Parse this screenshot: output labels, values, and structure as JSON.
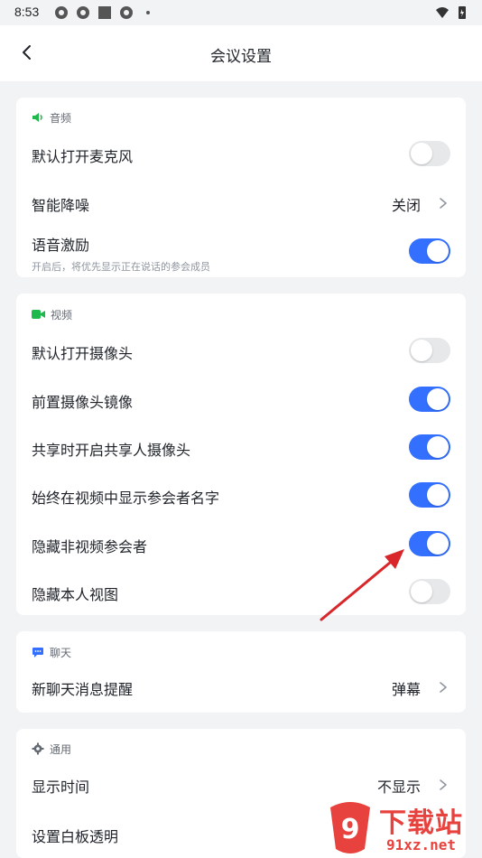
{
  "status_bar": {
    "time": "8:53"
  },
  "nav": {
    "title": "会议设置"
  },
  "sections": {
    "audio": {
      "header": "音频",
      "mic_default": {
        "label": "默认打开麦克风",
        "toggle": false
      },
      "noise": {
        "label": "智能降噪",
        "value": "关闭"
      },
      "voice_incentive": {
        "label": "语音激励",
        "sub": "开启后，将优先显示正在说话的参会成员",
        "toggle": true
      }
    },
    "video": {
      "header": "视频",
      "camera_default": {
        "label": "默认打开摄像头",
        "toggle": false
      },
      "front_mirror": {
        "label": "前置摄像头镜像",
        "toggle": true
      },
      "share_camera": {
        "label": "共享时开启共享人摄像头",
        "toggle": true
      },
      "show_names": {
        "label": "始终在视频中显示参会者名字",
        "toggle": true
      },
      "hide_non_video": {
        "label": "隐藏非视频参会者",
        "toggle": true
      },
      "hide_self": {
        "label": "隐藏本人视图",
        "toggle": false
      }
    },
    "chat": {
      "header": "聊天",
      "new_message": {
        "label": "新聊天消息提醒",
        "value": "弹幕"
      }
    },
    "general": {
      "header": "通用",
      "show_time": {
        "label": "显示时间",
        "value": "不显示"
      },
      "whiteboard": {
        "label": "设置白板透明"
      }
    }
  },
  "watermark": {
    "text": "下载站",
    "url": "91xz.net"
  },
  "colors": {
    "accent": "#3370ff",
    "icon_green": "#1fb84c",
    "icon_blue": "#3370ff",
    "annotation": "#d9262b"
  }
}
